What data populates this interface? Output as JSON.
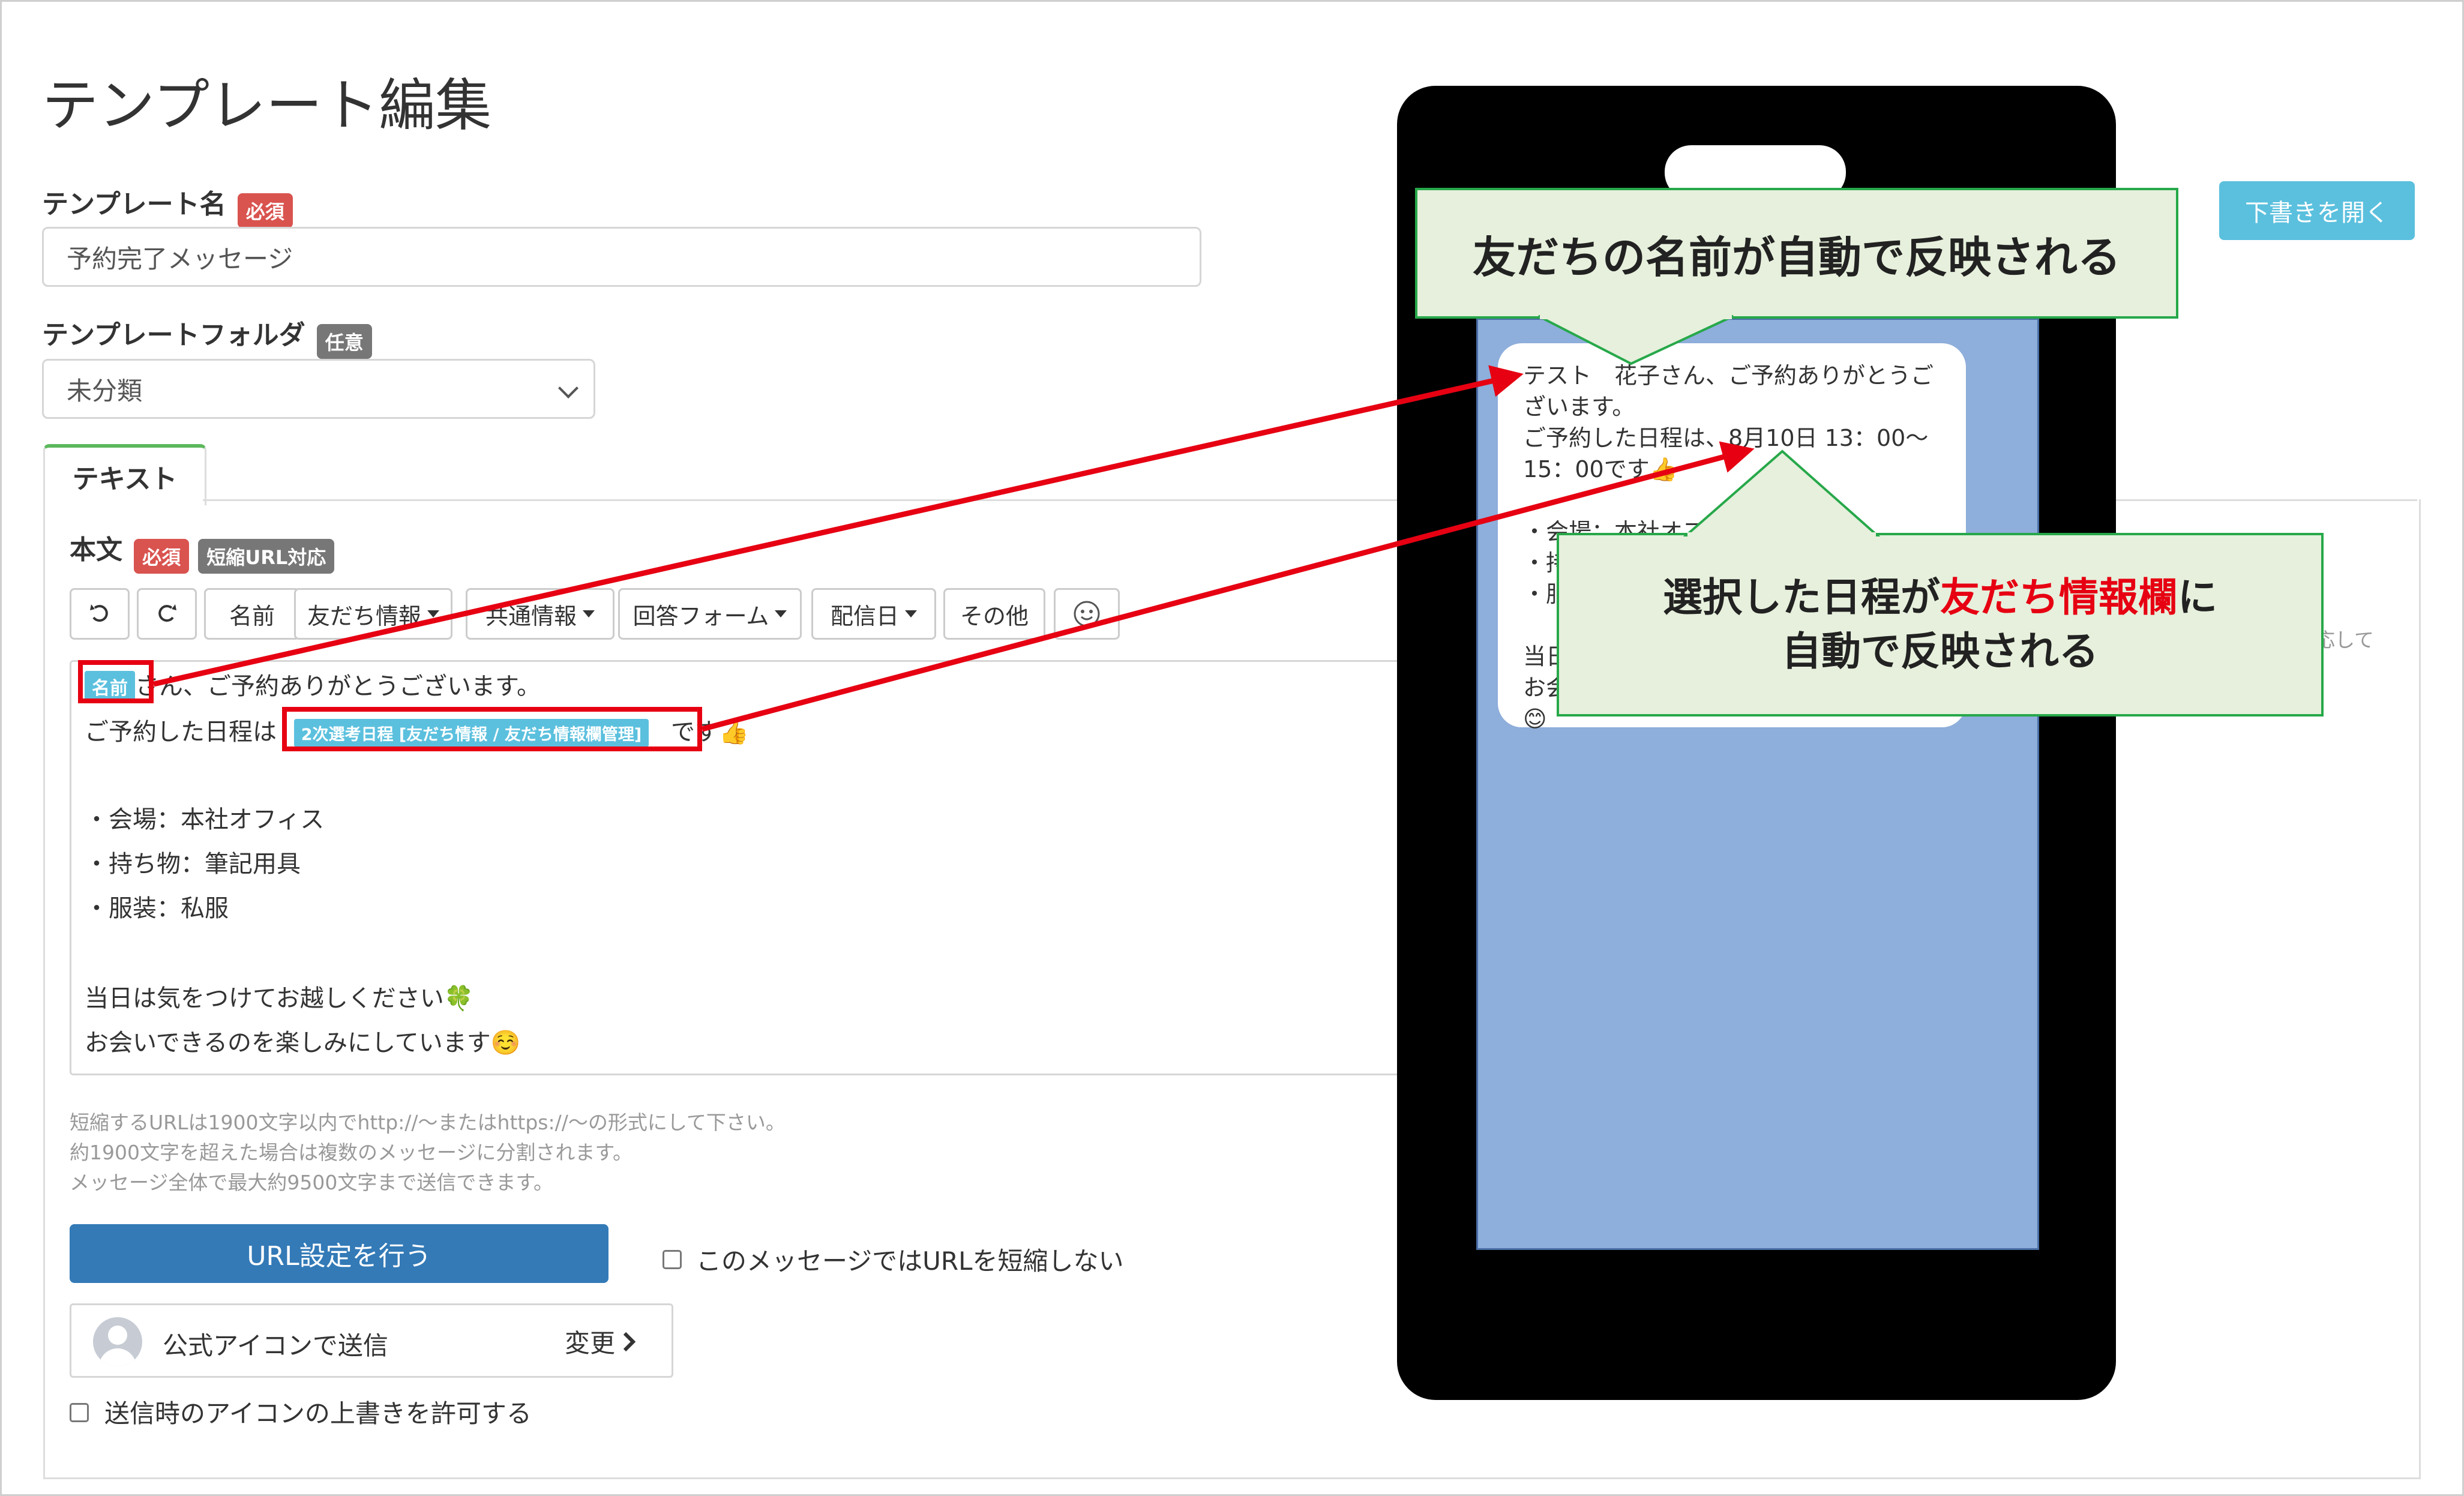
{
  "page": {
    "title": "テンプレート編集",
    "draft_button": "下書きを開く"
  },
  "template_name": {
    "label": "テンプレート名",
    "badge": "必須",
    "value": "予約完了メッセージ"
  },
  "template_folder": {
    "label": "テンプレートフォルダ",
    "badge": "任意",
    "selected": "未分類"
  },
  "tabs": [
    {
      "label": "テキスト"
    }
  ],
  "body": {
    "label": "本文",
    "badge_required": "必須",
    "badge_url": "短縮URL対応"
  },
  "toolbar": {
    "name": "名前",
    "friend_info": "友だち情報",
    "common_info": "共通情報",
    "answer_form": "回答フォーム",
    "delivery_date": "配信日",
    "other": "その他"
  },
  "editor": {
    "name_chip": "名前",
    "line1_rest": "さん、ご予約ありがとうございます。",
    "line2_pre": "ご予約した日程は",
    "schedule_chip": "2次選考日程 [友だち情報 / 友だち情報欄管理]",
    "line2_post": "です👍",
    "venue": "・会場：本社オフィス",
    "items": "・持ち物：筆記用具",
    "dress": "・服装：私服",
    "closing1": "当日は気をつけてお越しください🍀",
    "closing2": "お会いできるのを楽しみにしています☺️"
  },
  "hints": {
    "line1": "短縮するURLは1900文字以内でhttp://〜またはhttps://〜の形式にして下さい。",
    "line2": "約1900文字を超えた場合は複数のメッセージに分割されます。",
    "line3": "メッセージ全体で最大約9500文字まで送信できます。",
    "partial_right": "応して"
  },
  "url_button": "URL設定を行う",
  "no_shorten_label": "このメッセージではURLを短縮しない",
  "sender": {
    "label": "公式アイコンで送信",
    "change": "変更"
  },
  "allow_icon_label": "送信時のアイコンの上書きを許可する",
  "preview": {
    "bubble_text": "テスト　花子さん、ご予約ありがとうご\nざいます。\nご予約した日程は、8月10日 13：00〜\n15：00です👍\n\n・会場：本社オフ\n・持\n・服\n\n当日\nお会\n😊"
  },
  "callouts": {
    "top": "友だちの名前が自動で反映される",
    "bottom_pre": "選択した日程が",
    "bottom_red": "友だち情報欄",
    "bottom_post": "に",
    "bottom_line2": "自動で反映される"
  },
  "colors": {
    "required_badge": "#d9534f",
    "optional_badge": "#777777",
    "chip": "#5bc0de",
    "primary": "#337ab7",
    "info": "#5bc0de",
    "highlight_red": "#e60012",
    "callout_fill": "#e6f0dc",
    "callout_border": "#27a84a",
    "chat_background": "#8eaedb"
  }
}
